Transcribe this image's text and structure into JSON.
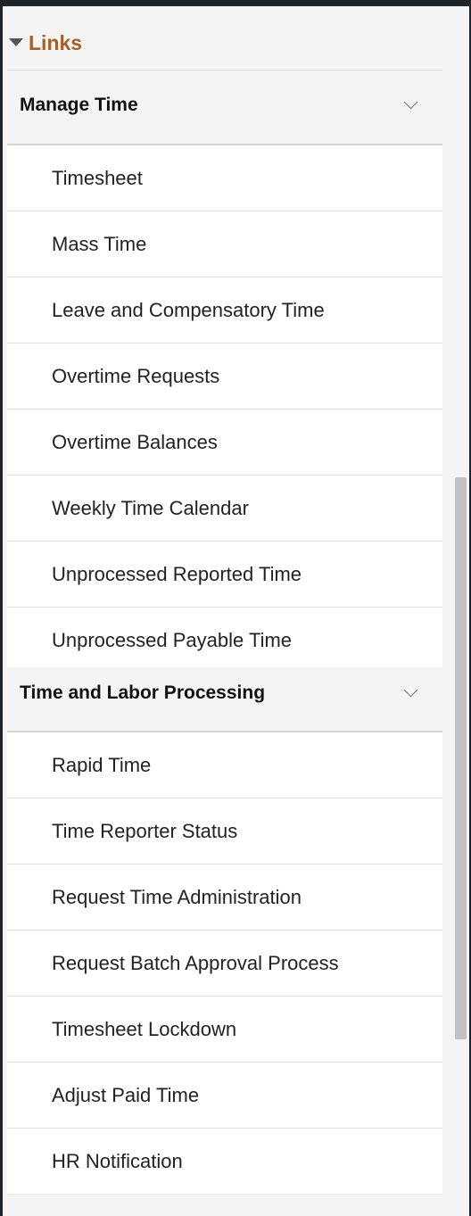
{
  "links_panel": {
    "title": "Links",
    "sections": [
      {
        "title": "Manage Time",
        "items": [
          "Timesheet",
          "Mass Time",
          "Leave and Compensatory Time",
          "Overtime Requests",
          "Overtime Balances",
          "Weekly Time Calendar",
          "Unprocessed Reported Time",
          "Unprocessed Payable Time"
        ]
      },
      {
        "title": "Time and Labor Processing",
        "items": [
          "Rapid Time",
          "Time Reporter Status",
          "Request Time Administration",
          "Request Batch Approval Process",
          "Timesheet Lockdown",
          "Adjust Paid Time",
          "HR Notification"
        ]
      }
    ]
  },
  "colors": {
    "links_title": "#a4602b",
    "background": "#f4f4f4",
    "item_background": "#ffffff",
    "scrollbar_thumb": "#c1c1c1"
  },
  "icons": {
    "links_toggle": "caret-down-icon",
    "section_toggle": "chevron-down-icon"
  }
}
